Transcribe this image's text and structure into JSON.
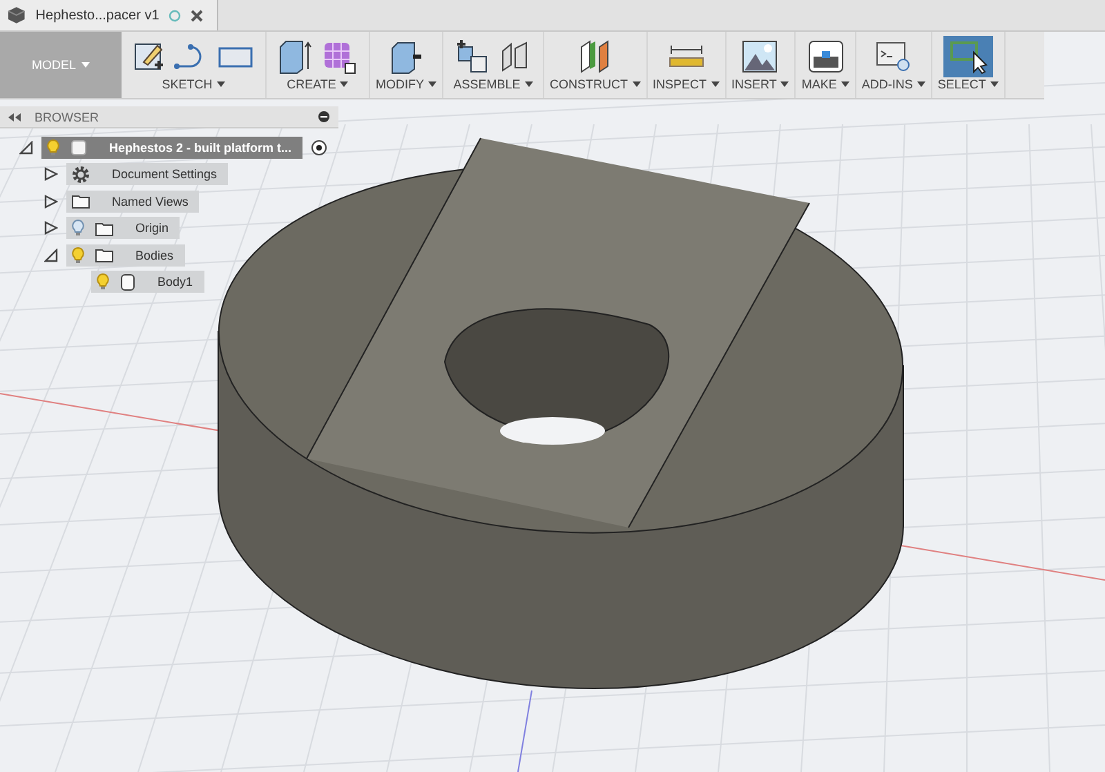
{
  "document_tab": {
    "title": "Hephesto...pacer v1"
  },
  "workspace": {
    "label": "MODEL"
  },
  "toolbar": [
    {
      "label": "SKETCH",
      "kind": "sketch",
      "selected": false
    },
    {
      "label": "CREATE",
      "kind": "create",
      "selected": false
    },
    {
      "label": "MODIFY",
      "kind": "modify",
      "selected": false
    },
    {
      "label": "ASSEMBLE",
      "kind": "assemble",
      "selected": false
    },
    {
      "label": "CONSTRUCT",
      "kind": "construct",
      "selected": false
    },
    {
      "label": "INSPECT",
      "kind": "inspect",
      "selected": false
    },
    {
      "label": "INSERT",
      "kind": "insert",
      "selected": false
    },
    {
      "label": "MAKE",
      "kind": "make",
      "selected": false
    },
    {
      "label": "ADD-INS",
      "kind": "addins",
      "selected": false
    },
    {
      "label": "SELECT",
      "kind": "select",
      "selected": true
    }
  ],
  "browser": {
    "title": "BROWSER",
    "tree": [
      {
        "label": "Hephestos 2 - built platform t...",
        "kind": "component",
        "visible": true,
        "expanded": true,
        "selected": true,
        "children": [
          {
            "label": "Document Settings",
            "kind": "settings",
            "expanded": false,
            "selected": false
          },
          {
            "label": "Named Views",
            "kind": "folder",
            "expanded": false,
            "selected": false
          },
          {
            "label": "Origin",
            "kind": "folder",
            "visible": false,
            "expanded": false,
            "selected": false
          },
          {
            "label": "Bodies",
            "kind": "folder",
            "visible": true,
            "expanded": true,
            "selected": false,
            "children": [
              {
                "label": "Body1",
                "kind": "body",
                "visible": true,
                "selected": false
              }
            ]
          }
        ]
      }
    ]
  }
}
